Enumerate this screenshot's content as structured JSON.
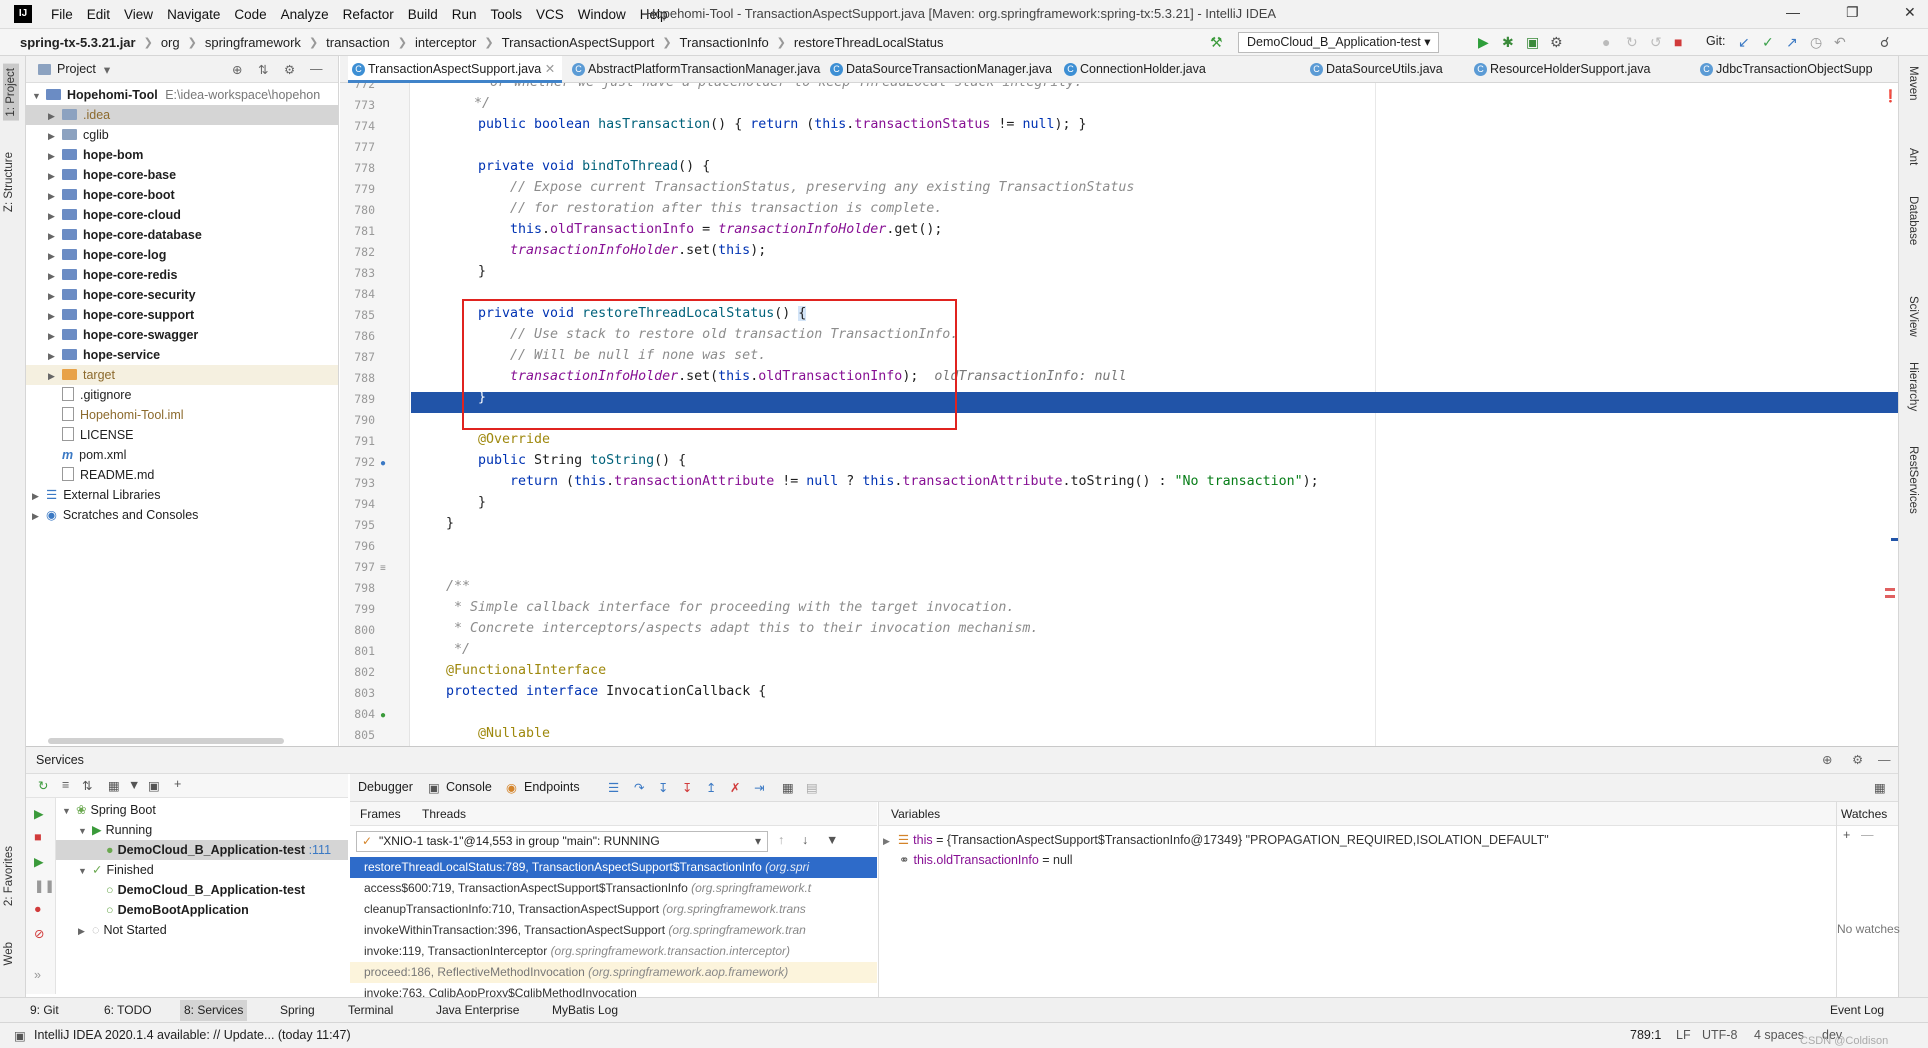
{
  "menubar": {
    "logo": "IJ",
    "items": [
      "File",
      "Edit",
      "View",
      "Navigate",
      "Code",
      "Analyze",
      "Refactor",
      "Build",
      "Run",
      "Tools",
      "VCS",
      "Window",
      "Help"
    ],
    "title": "Hopehomi-Tool - TransactionAspectSupport.java [Maven: org.springframework:spring-tx:5.3.21] - IntelliJ IDEA"
  },
  "navbar": {
    "breadcrumbs": [
      "spring-tx-5.3.21.jar",
      "org",
      "springframework",
      "transaction",
      "interceptor",
      "TransactionAspectSupport",
      "TransactionInfo",
      "restoreThreadLocalStatus"
    ],
    "run_config": "DemoCloud_B_Application-test",
    "git_label": "Git:"
  },
  "left_stripe": {
    "project": "1: Project",
    "structure": "Z: Structure",
    "favorites": "2: Favorites",
    "web": "Web"
  },
  "right_stripe": [
    "Maven",
    "Ant",
    "Database",
    "SciView",
    "Hierarchy",
    "RestServices"
  ],
  "project_panel": {
    "title": "Project",
    "root": {
      "name": "Hopehomi-Tool",
      "path": "E:\\idea-workspace\\hopehon"
    },
    "items": [
      {
        "label": ".idea",
        "type": "folder"
      },
      {
        "label": "cglib",
        "type": "folder"
      },
      {
        "label": "hope-bom",
        "type": "module"
      },
      {
        "label": "hope-core-base",
        "type": "module"
      },
      {
        "label": "hope-core-boot",
        "type": "module"
      },
      {
        "label": "hope-core-cloud",
        "type": "module"
      },
      {
        "label": "hope-core-database",
        "type": "module"
      },
      {
        "label": "hope-core-log",
        "type": "module"
      },
      {
        "label": "hope-core-redis",
        "type": "module"
      },
      {
        "label": "hope-core-security",
        "type": "module"
      },
      {
        "label": "hope-core-support",
        "type": "module"
      },
      {
        "label": "hope-core-swagger",
        "type": "module"
      },
      {
        "label": "hope-service",
        "type": "module"
      },
      {
        "label": "target",
        "type": "orange-folder"
      },
      {
        "label": ".gitignore",
        "type": "file"
      },
      {
        "label": "Hopehomi-Tool.iml",
        "type": "file"
      },
      {
        "label": "LICENSE",
        "type": "file"
      },
      {
        "label": "pom.xml",
        "type": "file"
      },
      {
        "label": "README.md",
        "type": "file"
      },
      {
        "label": "External Libraries",
        "type": "lib"
      },
      {
        "label": "Scratches and Consoles",
        "type": "scratch"
      }
    ]
  },
  "editor_tabs": [
    {
      "label": "TransactionAspectSupport.java",
      "active": true
    },
    {
      "label": "AbstractPlatformTransactionManager.java",
      "active": false
    },
    {
      "label": "DataSourceTransactionManager.java",
      "active": false
    },
    {
      "label": "ConnectionHolder.java",
      "active": false
    },
    {
      "label": "DataSourceUtils.java",
      "active": false
    },
    {
      "label": "ResourceHolderSupport.java",
      "active": false
    },
    {
      "label": "JdbcTransactionObjectSupp",
      "active": false
    }
  ],
  "editor": {
    "line_numbers": [
      "772",
      "773",
      "774",
      "777",
      "778",
      "779",
      "780",
      "781",
      "782",
      "783",
      "784",
      "785",
      "786",
      "787",
      "788",
      "789",
      "790",
      "791",
      "792",
      "793",
      "794",
      "795",
      "796",
      "797",
      "798",
      "799",
      "800",
      "801",
      "802",
      "803",
      "804",
      "805"
    ],
    "current_line": "789",
    "inline_debug_value": "oldTransactionInfo: null"
  },
  "services": {
    "title": "Services",
    "tree": {
      "spring_boot": "Spring Boot",
      "running": "Running",
      "running_app": "DemoCloud_B_Application-test",
      "running_port": ":111",
      "finished": "Finished",
      "finished_apps": [
        "DemoCloud_B_Application-test",
        "DemoBootApplication"
      ],
      "not_started": "Not Started"
    },
    "debugger_tabs": [
      "Debugger",
      "Console",
      "Endpoints"
    ],
    "frames_tab": "Frames",
    "threads_tab": "Threads",
    "thread_selector": "\"XNIO-1 task-1\"@14,553 in group \"main\": RUNNING",
    "frames": [
      {
        "method": "restoreThreadLocalStatus:789, TransactionAspectSupport$TransactionInfo",
        "pkg": "(org.spri",
        "state": "selected"
      },
      {
        "method": "access$600:719, TransactionAspectSupport$TransactionInfo",
        "pkg": "(org.springframework.t",
        "state": "normal"
      },
      {
        "method": "cleanupTransactionInfo:710, TransactionAspectSupport",
        "pkg": "(org.springframework.trans",
        "state": "normal"
      },
      {
        "method": "invokeWithinTransaction:396, TransactionAspectSupport",
        "pkg": "(org.springframework.tran",
        "state": "normal"
      },
      {
        "method": "invoke:119, TransactionInterceptor",
        "pkg": "(org.springframework.transaction.interceptor)",
        "state": "normal"
      },
      {
        "method": "proceed:186, ReflectiveMethodInvocation",
        "pkg": "(org.springframework.aop.framework)",
        "state": "lib"
      },
      {
        "method": "invoke:763, CglibAopProxy$CglibMethodInvocation",
        "pkg": "",
        "state": "normal"
      }
    ],
    "variables_title": "Variables",
    "variables": [
      {
        "name": "this",
        "value": "{TransactionAspectSupport$TransactionInfo@17349} \"PROPAGATION_REQUIRED,ISOLATION_DEFAULT\""
      },
      {
        "name": "this.oldTransactionInfo",
        "value": "null"
      }
    ],
    "watches_title": "Watches",
    "no_watches": "No watches"
  },
  "tool_tabs": [
    {
      "label": "9: Git",
      "active": false
    },
    {
      "label": "6: TODO",
      "active": false
    },
    {
      "label": "8: Services",
      "active": true
    },
    {
      "label": "Spring",
      "active": false
    },
    {
      "label": "Terminal",
      "active": false
    },
    {
      "label": "Java Enterprise",
      "active": false
    },
    {
      "label": "MyBatis Log",
      "active": false
    }
  ],
  "event_log": "Event Log",
  "statusbar": {
    "message": "IntelliJ IDEA 2020.1.4 available: // Update... (today 11:47)",
    "position": "789:1",
    "line_sep": "LF",
    "encoding": "UTF-8",
    "indent": "4 spaces",
    "branch": "dev",
    "watermark": "CSDN @Coldison"
  },
  "colors": {
    "accent": "#2154a8",
    "selection": "#2e6bc9",
    "highlight_box": "#e0231f"
  }
}
